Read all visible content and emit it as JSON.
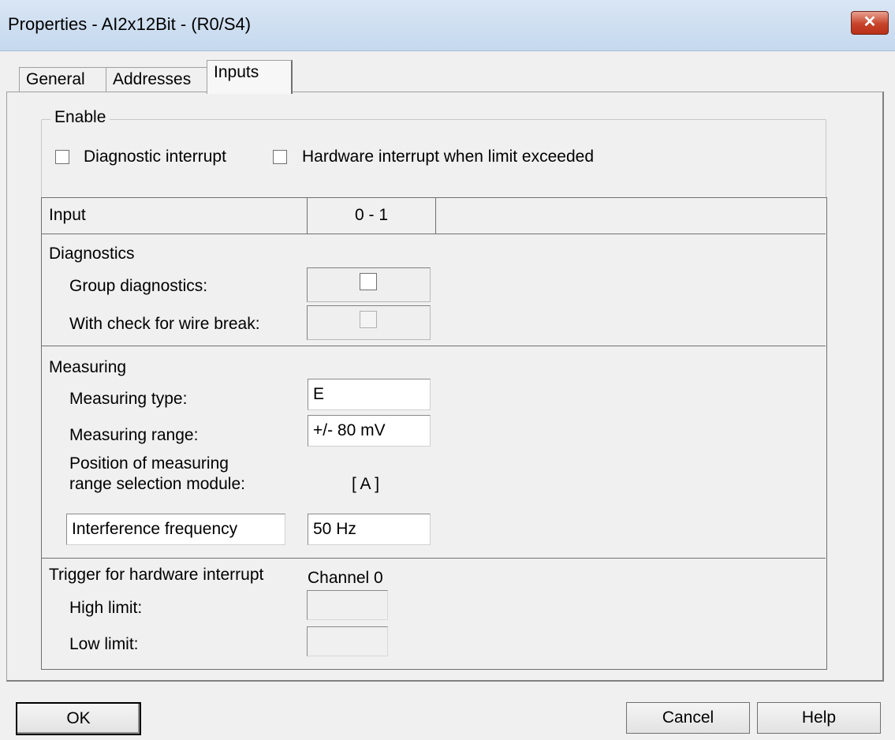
{
  "window": {
    "title": "Properties - AI2x12Bit - (R0/S4)",
    "close_glyph": "✕"
  },
  "tabs": [
    {
      "label": "General"
    },
    {
      "label": "Addresses"
    },
    {
      "label": "Inputs",
      "active": true
    }
  ],
  "enable": {
    "legend": "Enable",
    "diagnostic_interrupt": {
      "label": "Diagnostic interrupt",
      "checked": false
    },
    "hardware_interrupt": {
      "label": "Hardware interrupt when limit exceeded",
      "checked": false
    }
  },
  "table": {
    "header": {
      "input_label": "Input",
      "channel_group": "0 - 1"
    },
    "diagnostics": {
      "title": "Diagnostics",
      "group_diagnostics_label": "Group diagnostics:",
      "wire_break_label": "With check for wire break:"
    },
    "measuring": {
      "title": "Measuring",
      "type_label": "Measuring type:",
      "type_value": "E",
      "range_label": "Measuring range:",
      "range_value": "+/- 80 mV",
      "position_label_line1": "Position of measuring",
      "position_label_line2": "range selection module:",
      "position_value": "[ A ]",
      "interference_label": "Interference frequency",
      "interference_value": "50 Hz"
    },
    "trigger": {
      "title": "Trigger for hardware interrupt",
      "channel": "Channel 0",
      "high_limit_label": "High limit:",
      "low_limit_label": "Low limit:"
    }
  },
  "buttons": {
    "ok": "OK",
    "cancel": "Cancel",
    "help": "Help"
  }
}
